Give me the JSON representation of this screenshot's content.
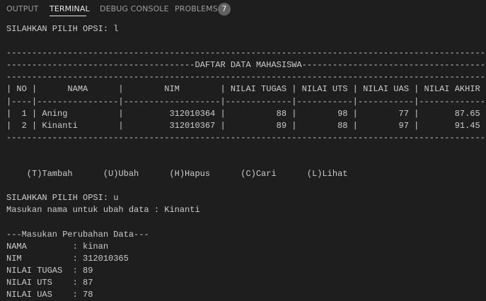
{
  "tabs": {
    "output": "OUTPUT",
    "terminal": "TERMINAL",
    "debug_console": "DEBUG CONSOLE",
    "problems": "PROBLEMS",
    "problems_count": "7"
  },
  "terminal": {
    "lines": [
      "SILAHKAN PILIH OPSI: l",
      "",
      "-----------------------------------------------------------------------------------------------",
      "-------------------------------------DAFTAR DATA MAHASISWA--------------------------------------",
      "-----------------------------------------------------------------------------------------------",
      "| NO |      NAMA      |        NIM        | NILAI TUGAS | NILAI UTS | NILAI UAS | NILAI AKHIR |",
      "|----|----------------|-------------------|-------------|-----------|-----------|-------------|",
      "|  1 | Aning          |         312010364 |          88 |        98 |        77 |       87.65 |",
      "|  2 | Kinanti        |         312010367 |          89 |        88 |        97 |       91.45 |",
      "-----------------------------------------------------------------------------------------------",
      "",
      "",
      "    (T)Tambah      (U)Ubah      (H)Hapus      (C)Cari      (L)Lihat",
      "",
      "SILAHKAN PILIH OPSI: u",
      "Masukan nama untuk ubah data : Kinanti",
      "",
      "---Masukan Perubahan Data---",
      "NAMA         : kinan",
      "NIM          : 312010365",
      "NILAI TUGAS  : 89",
      "NILAI UTS    : 87",
      "NILAI UAS    : 78"
    ]
  }
}
